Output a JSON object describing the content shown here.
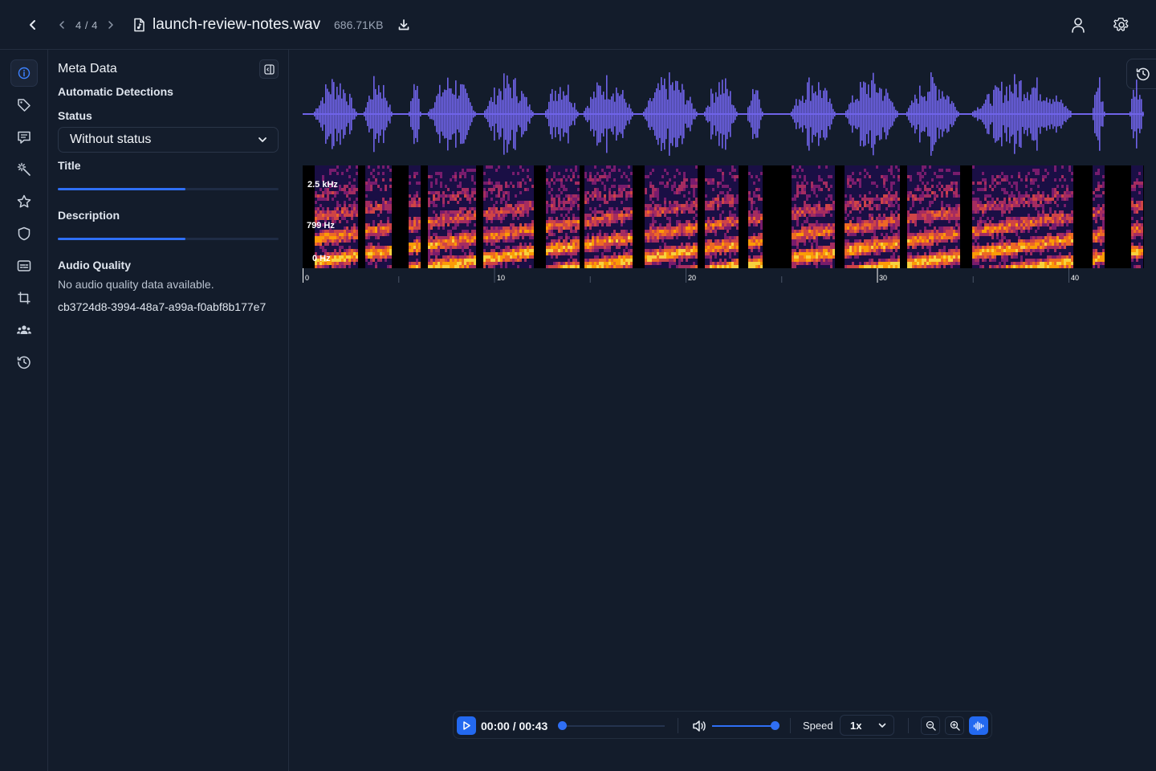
{
  "header": {
    "page_counter": "4 / 4",
    "file_name": "launch-review-notes.wav",
    "file_size": "686.71KB"
  },
  "sidebar": {
    "items": [
      {
        "name": "info-icon",
        "active": true
      },
      {
        "name": "tag-icon"
      },
      {
        "name": "comment-icon"
      },
      {
        "name": "magic-icon"
      },
      {
        "name": "star-icon"
      },
      {
        "name": "shield-icon"
      },
      {
        "name": "subtitles-icon"
      },
      {
        "name": "crop-icon"
      },
      {
        "name": "users-icon"
      },
      {
        "name": "history-icon"
      }
    ]
  },
  "meta": {
    "title": "Meta Data",
    "automatic_detections": "Automatic Detections",
    "status_label": "Status",
    "status_value": "Without status",
    "title_label": "Title",
    "description_label": "Description",
    "audio_quality_label": "Audio Quality",
    "audio_quality_text": "No audio quality data available.",
    "id": "cb3724d8-3994-48a7-a99a-f0abf8b177e7"
  },
  "spectrogram": {
    "freq_labels": [
      "2.5 kHz",
      "799 Hz",
      "0 Hz"
    ],
    "time_ticks": [
      "0",
      "10",
      "20",
      "30",
      "40"
    ]
  },
  "player": {
    "time": "00:00 / 00:43",
    "volume": 1.0,
    "speed_label": "Speed",
    "speed_value": "1x"
  },
  "colors": {
    "accent": "#2f6ff5",
    "waveform": "#6f63e8"
  }
}
